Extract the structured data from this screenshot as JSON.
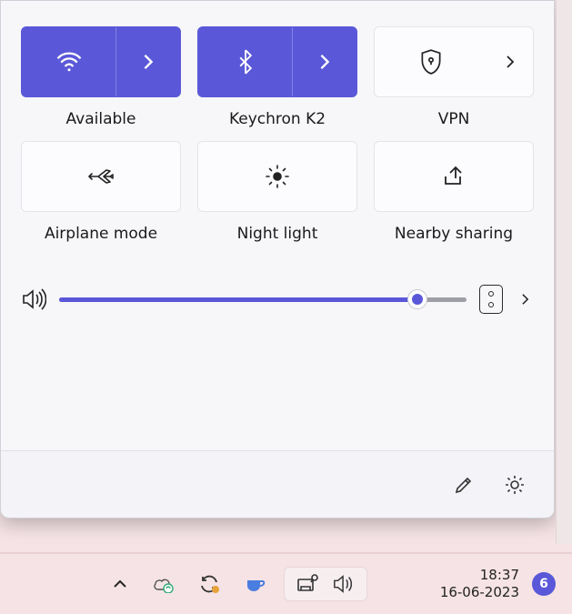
{
  "accent": "#5a58d8",
  "tiles": {
    "wifi": {
      "label": "Available",
      "icon": "wifi-icon",
      "active": true,
      "expandable": true
    },
    "bt": {
      "label": "Keychron K2",
      "icon": "bluetooth-icon",
      "active": true,
      "expandable": true
    },
    "vpn": {
      "label": "VPN",
      "icon": "shield-icon",
      "active": false,
      "expandable": true
    },
    "airplane": {
      "label": "Airplane mode",
      "icon": "airplane-icon",
      "active": false,
      "expandable": false
    },
    "night": {
      "label": "Night light",
      "icon": "sun-icon",
      "active": false,
      "expandable": false
    },
    "nearby": {
      "label": "Nearby sharing",
      "icon": "share-icon",
      "active": false,
      "expandable": false
    }
  },
  "volume": {
    "value": 88,
    "max": 100
  },
  "taskbar": {
    "time": "18:37",
    "date": "16-06-2023",
    "notification_count": "6"
  }
}
